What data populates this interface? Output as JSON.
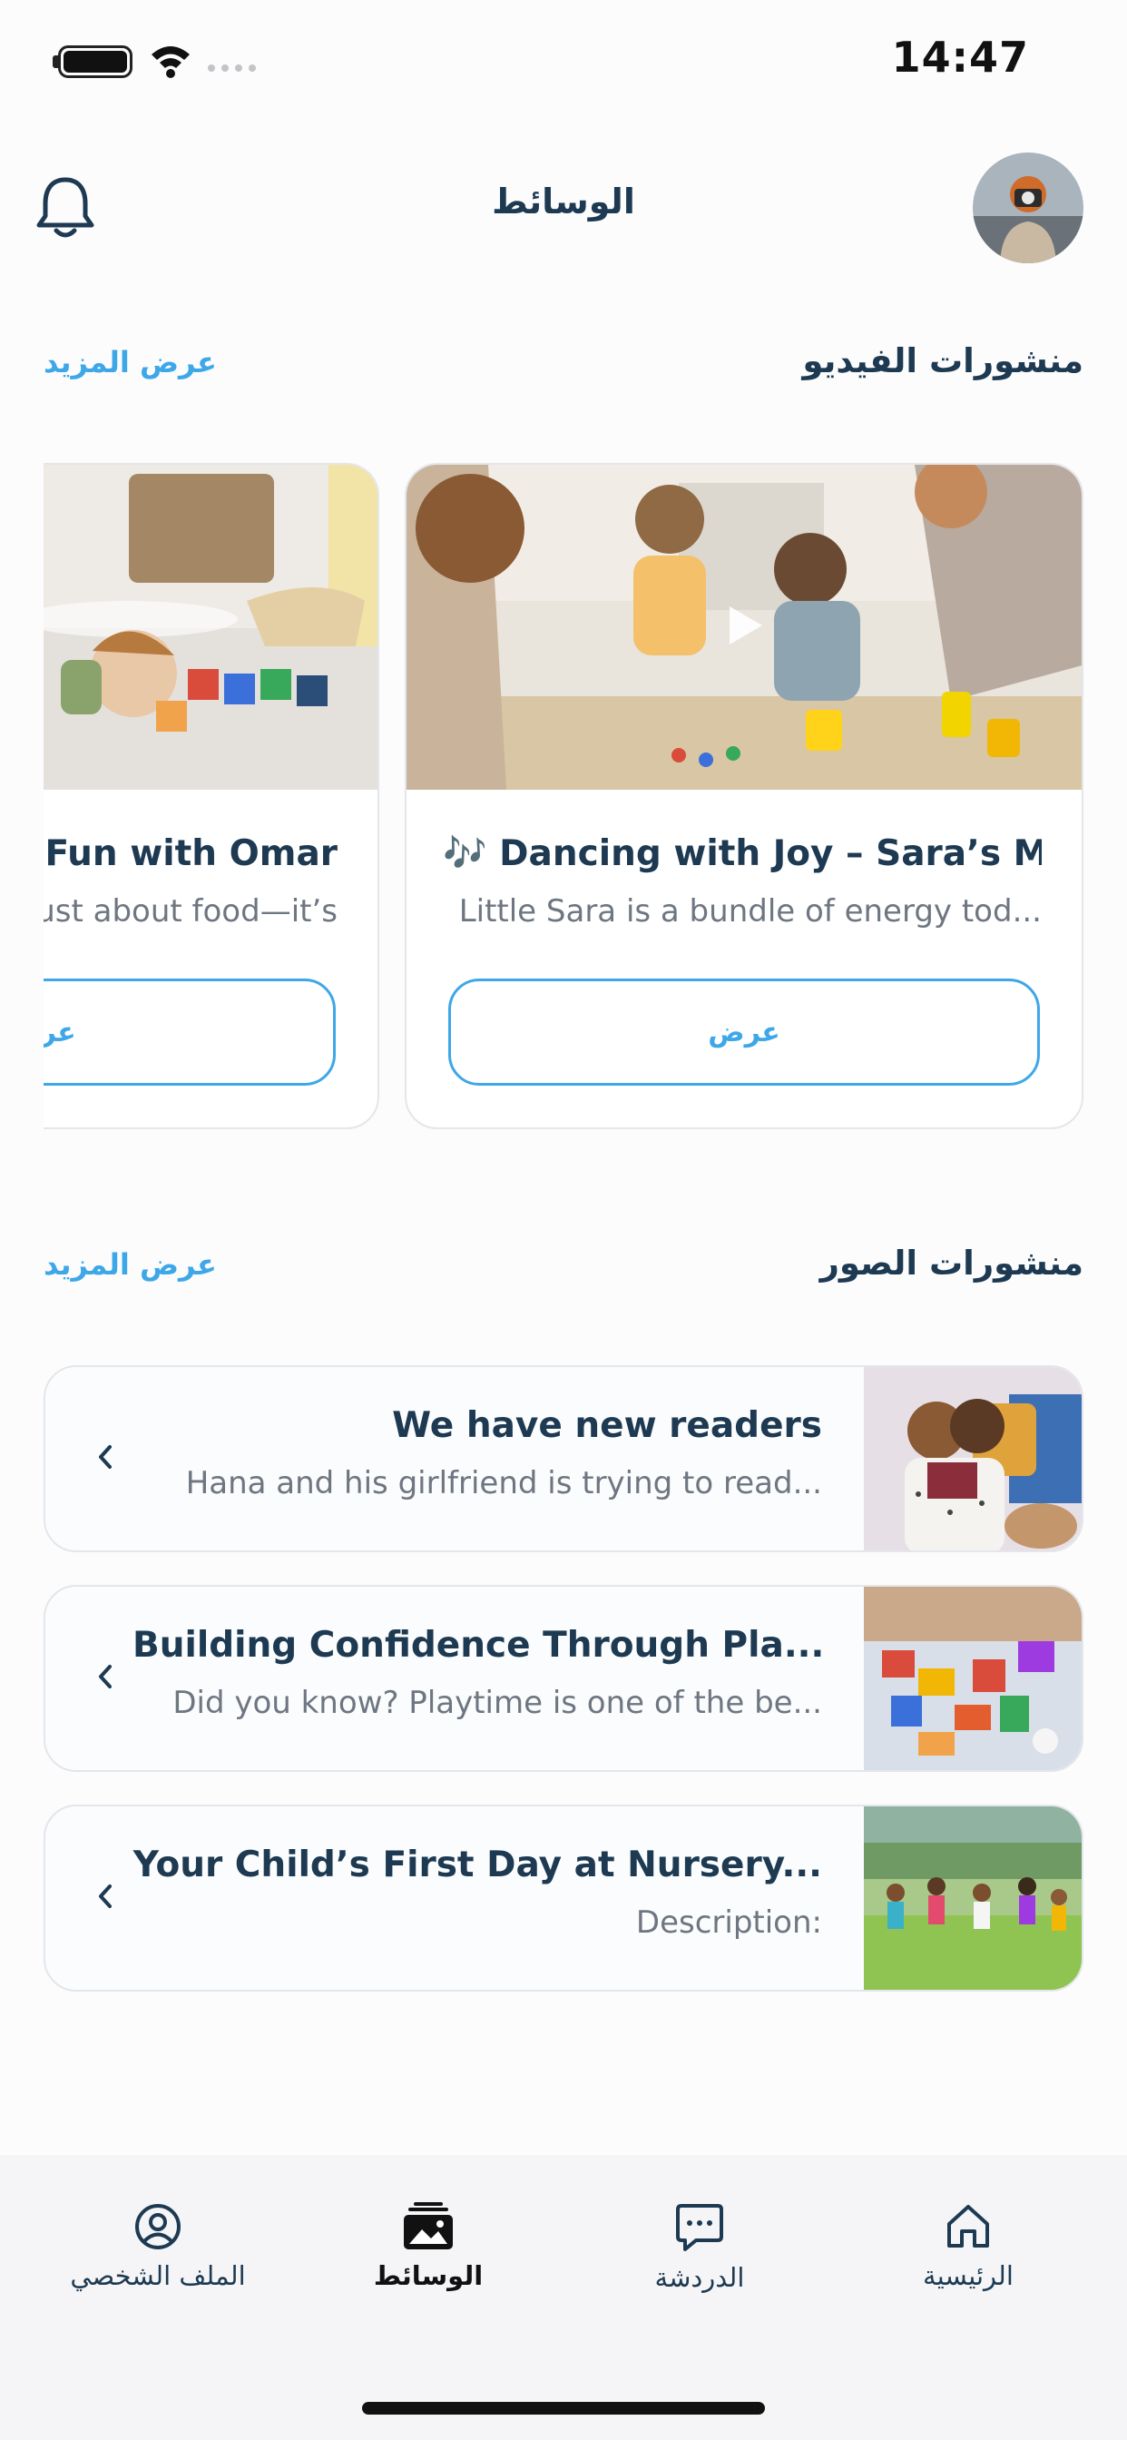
{
  "status_bar": {
    "time": "14:47"
  },
  "header": {
    "title": "الوسائط"
  },
  "video_section": {
    "title": "منشورات الفيديو",
    "more_label": "عرض المزيد",
    "cards": [
      {
        "title": "🎶 Dancing with Joy – Sara’s M...",
        "description": "Little Sara is a bundle of energy tod...",
        "button_label": "عرض"
      },
      {
        "title": "🍎 Fun with Omar",
        "description": "Not just about food—it’s",
        "button_label": "عرض"
      }
    ]
  },
  "photo_section": {
    "title": "منشورات الصور",
    "more_label": "عرض المزيد",
    "items": [
      {
        "title": "We have new readers",
        "description": "Hana and his girlfriend is trying to read..."
      },
      {
        "title": "Building Confidence Through Pla...",
        "description": "Did you know? Playtime is one of the be..."
      },
      {
        "title": "Your Child’s First Day at Nursery...",
        "description": "Description:"
      }
    ]
  },
  "tab_bar": {
    "tabs": [
      {
        "label": "الملف الشخصي",
        "icon": "profile-icon"
      },
      {
        "label": "الوسائط",
        "icon": "media-icon",
        "active": true
      },
      {
        "label": "الدردشة",
        "icon": "chat-icon"
      },
      {
        "label": "الرئيسية",
        "icon": "home-icon"
      }
    ]
  },
  "colors": {
    "accent": "#3ea7e8",
    "primary_text": "#1d3a52",
    "secondary_text": "#6e7681"
  }
}
